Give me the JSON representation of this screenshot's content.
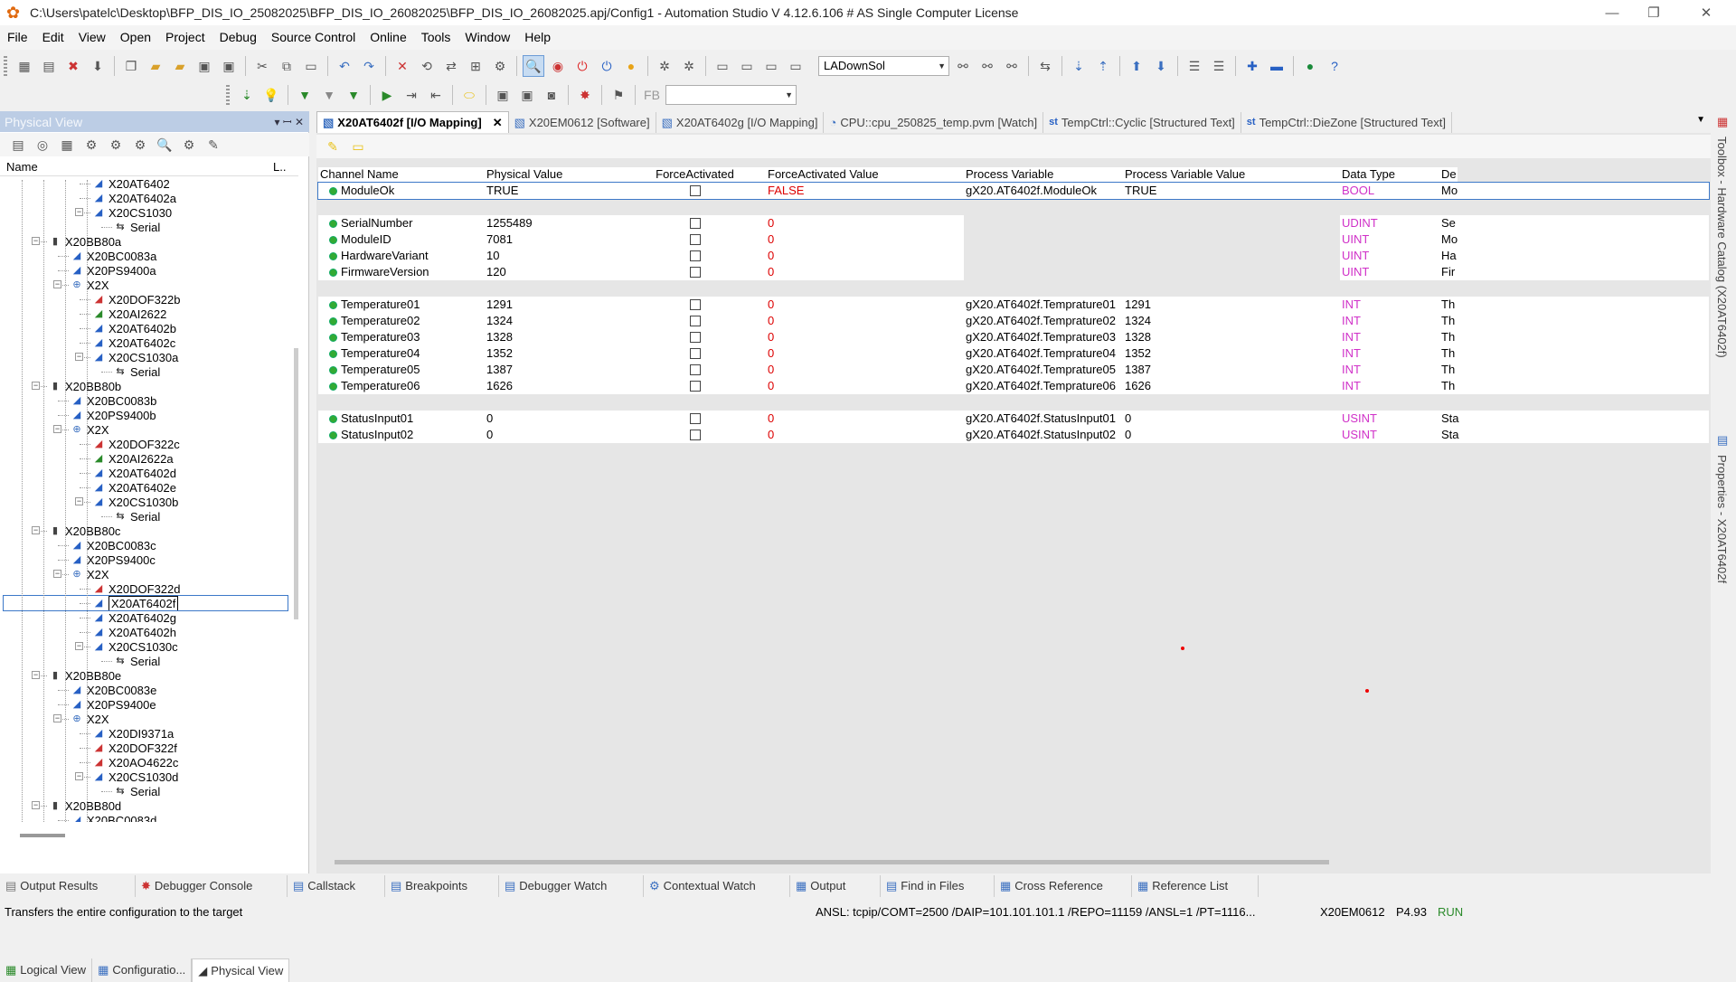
{
  "window": {
    "title": "C:\\Users\\patelc\\Desktop\\BFP_DIS_IO_25082025\\BFP_DIS_IO_26082025\\BFP_DIS_IO_26082025.apj/Config1 - Automation Studio V 4.12.6.106 # AS Single Computer License",
    "minimize": "—",
    "restore": "❐",
    "close": "✕"
  },
  "menu": [
    "File",
    "Edit",
    "View",
    "Open",
    "Project",
    "Debug",
    "Source Control",
    "Online",
    "Tools",
    "Window",
    "Help"
  ],
  "toolbar": {
    "combo_value": "LADownSol",
    "combo2_value": ""
  },
  "physical_view": {
    "title": "Physical View",
    "pin": "▾ ꟷ ✕",
    "col_name": "Name",
    "col_l": "L..",
    "tree": [
      {
        "label": "X20AT6402",
        "indent": 3,
        "icon": "module"
      },
      {
        "label": "X20AT6402a",
        "indent": 3,
        "icon": "module"
      },
      {
        "label": "X20CS1030",
        "indent": 3,
        "icon": "module",
        "expander": "-"
      },
      {
        "label": "Serial",
        "indent": 4,
        "icon": "serial"
      },
      {
        "label": "X20BB80a",
        "indent": 1,
        "icon": "bus",
        "expander": "-"
      },
      {
        "label": "X20BC0083a",
        "indent": 2,
        "icon": "module"
      },
      {
        "label": "X20PS9400a",
        "indent": 2,
        "icon": "module"
      },
      {
        "label": "X2X",
        "indent": 2,
        "icon": "x2x",
        "expander": "-"
      },
      {
        "label": "X20DOF322b",
        "indent": 3,
        "icon": "module-red"
      },
      {
        "label": "X20AI2622",
        "indent": 3,
        "icon": "module-green"
      },
      {
        "label": "X20AT6402b",
        "indent": 3,
        "icon": "module"
      },
      {
        "label": "X20AT6402c",
        "indent": 3,
        "icon": "module"
      },
      {
        "label": "X20CS1030a",
        "indent": 3,
        "icon": "module",
        "expander": "-"
      },
      {
        "label": "Serial",
        "indent": 4,
        "icon": "serial"
      },
      {
        "label": "X20BB80b",
        "indent": 1,
        "icon": "bus",
        "expander": "-"
      },
      {
        "label": "X20BC0083b",
        "indent": 2,
        "icon": "module"
      },
      {
        "label": "X20PS9400b",
        "indent": 2,
        "icon": "module"
      },
      {
        "label": "X2X",
        "indent": 2,
        "icon": "x2x",
        "expander": "-"
      },
      {
        "label": "X20DOF322c",
        "indent": 3,
        "icon": "module-red"
      },
      {
        "label": "X20AI2622a",
        "indent": 3,
        "icon": "module-green"
      },
      {
        "label": "X20AT6402d",
        "indent": 3,
        "icon": "module"
      },
      {
        "label": "X20AT6402e",
        "indent": 3,
        "icon": "module"
      },
      {
        "label": "X20CS1030b",
        "indent": 3,
        "icon": "module",
        "expander": "-"
      },
      {
        "label": "Serial",
        "indent": 4,
        "icon": "serial"
      },
      {
        "label": "X20BB80c",
        "indent": 1,
        "icon": "bus",
        "expander": "-"
      },
      {
        "label": "X20BC0083c",
        "indent": 2,
        "icon": "module"
      },
      {
        "label": "X20PS9400c",
        "indent": 2,
        "icon": "module"
      },
      {
        "label": "X2X",
        "indent": 2,
        "icon": "x2x",
        "expander": "-"
      },
      {
        "label": "X20DOF322d",
        "indent": 3,
        "icon": "module-red"
      },
      {
        "label": "X20AT6402f",
        "indent": 3,
        "icon": "module",
        "selected": true
      },
      {
        "label": "X20AT6402g",
        "indent": 3,
        "icon": "module"
      },
      {
        "label": "X20AT6402h",
        "indent": 3,
        "icon": "module"
      },
      {
        "label": "X20CS1030c",
        "indent": 3,
        "icon": "module",
        "expander": "-"
      },
      {
        "label": "Serial",
        "indent": 4,
        "icon": "serial"
      },
      {
        "label": "X20BB80e",
        "indent": 1,
        "icon": "bus",
        "expander": "-"
      },
      {
        "label": "X20BC0083e",
        "indent": 2,
        "icon": "module"
      },
      {
        "label": "X20PS9400e",
        "indent": 2,
        "icon": "module"
      },
      {
        "label": "X2X",
        "indent": 2,
        "icon": "x2x",
        "expander": "-"
      },
      {
        "label": "X20DI9371a",
        "indent": 3,
        "icon": "module"
      },
      {
        "label": "X20DOF322f",
        "indent": 3,
        "icon": "module-red"
      },
      {
        "label": "X20AO4622c",
        "indent": 3,
        "icon": "module-red"
      },
      {
        "label": "X20CS1030d",
        "indent": 3,
        "icon": "module",
        "expander": "-"
      },
      {
        "label": "Serial",
        "indent": 4,
        "icon": "serial"
      },
      {
        "label": "X20BB80d",
        "indent": 1,
        "icon": "bus",
        "expander": "-"
      },
      {
        "label": "X20BC0083d",
        "indent": 2,
        "icon": "module"
      }
    ],
    "tabs": [
      {
        "label": "Logical View",
        "active": false
      },
      {
        "label": "Configuratio...",
        "active": false
      },
      {
        "label": "Physical View",
        "active": true
      }
    ]
  },
  "doc_tabs": [
    {
      "label": "X20AT6402f [I/O Mapping]",
      "active": true
    },
    {
      "label": "X20EM0612 [Software]",
      "active": false
    },
    {
      "label": "X20AT6402g [I/O Mapping]",
      "active": false
    },
    {
      "label": "CPU::cpu_250825_temp.pvm [Watch]",
      "active": false
    },
    {
      "label": "TempCtrl::Cyclic [Structured Text]",
      "active": false
    },
    {
      "label": "TempCtrl::DieZone [Structured Text]",
      "active": false
    }
  ],
  "grid": {
    "headers": [
      "Channel Name",
      "Physical Value",
      "ForceActivated",
      "ForceActivated Value",
      "Process Variable",
      "Process Variable Value",
      "Data Type",
      "De"
    ],
    "rows": [
      {
        "name": "ModuleOk",
        "phys": "TRUE",
        "fav": "FALSE",
        "pv": "gX20.AT6402f.ModuleOk",
        "pvv": "TRUE",
        "type": "BOOL",
        "desc": "Mo",
        "group": 0
      },
      {
        "name": "SerialNumber",
        "phys": "1255489",
        "fav": "0",
        "pv": "",
        "pvv": "",
        "type": "UDINT",
        "desc": "Se",
        "group": 1
      },
      {
        "name": "ModuleID",
        "phys": "7081",
        "fav": "0",
        "pv": "",
        "pvv": "",
        "type": "UINT",
        "desc": "Mo",
        "group": 1
      },
      {
        "name": "HardwareVariant",
        "phys": "10",
        "fav": "0",
        "pv": "",
        "pvv": "",
        "type": "UINT",
        "desc": "Ha",
        "group": 1
      },
      {
        "name": "FirmwareVersion",
        "phys": "120",
        "fav": "0",
        "pv": "",
        "pvv": "",
        "type": "UINT",
        "desc": "Fir",
        "group": 1
      },
      {
        "name": "Temperature01",
        "phys": "1291",
        "fav": "0",
        "pv": "gX20.AT6402f.Temprature01",
        "pvv": "1291",
        "type": "INT",
        "desc": "Th",
        "group": 2
      },
      {
        "name": "Temperature02",
        "phys": "1324",
        "fav": "0",
        "pv": "gX20.AT6402f.Temprature02",
        "pvv": "1324",
        "type": "INT",
        "desc": "Th",
        "group": 2
      },
      {
        "name": "Temperature03",
        "phys": "1328",
        "fav": "0",
        "pv": "gX20.AT6402f.Temprature03",
        "pvv": "1328",
        "type": "INT",
        "desc": "Th",
        "group": 2
      },
      {
        "name": "Temperature04",
        "phys": "1352",
        "fav": "0",
        "pv": "gX20.AT6402f.Temprature04",
        "pvv": "1352",
        "type": "INT",
        "desc": "Th",
        "group": 2
      },
      {
        "name": "Temperature05",
        "phys": "1387",
        "fav": "0",
        "pv": "gX20.AT6402f.Temprature05",
        "pvv": "1387",
        "type": "INT",
        "desc": "Th",
        "group": 2
      },
      {
        "name": "Temperature06",
        "phys": "1626",
        "fav": "0",
        "pv": "gX20.AT6402f.Temprature06",
        "pvv": "1626",
        "type": "INT",
        "desc": "Th",
        "group": 2
      },
      {
        "name": "StatusInput01",
        "phys": "0",
        "fav": "0",
        "pv": "gX20.AT6402f.StatusInput01",
        "pvv": "0",
        "type": "USINT",
        "desc": "Sta",
        "group": 3
      },
      {
        "name": "StatusInput02",
        "phys": "0",
        "fav": "0",
        "pv": "gX20.AT6402f.StatusInput02",
        "pvv": "0",
        "type": "USINT",
        "desc": "Sta",
        "group": 3
      }
    ]
  },
  "side_panel": {
    "toolbox": "Toolbox - Hardware Catalog (X20AT6402f)",
    "properties": "Properties - X20AT6402f"
  },
  "bottom_tabs": [
    "Output Results",
    "Debugger Console",
    "Callstack",
    "Breakpoints",
    "Debugger Watch",
    "Contextual Watch",
    "Output",
    "Find in Files",
    "Cross Reference",
    "Reference List"
  ],
  "status": {
    "message": "Transfers the entire configuration to the target",
    "connection": "ANSL: tcpip/COMT=2500 /DAIP=101.101.101.1 /REPO=11159 /ANSL=1 /PT=1116...",
    "cpu": "X20EM0612",
    "version": "P4.93",
    "state": "RUN"
  },
  "colors": {
    "accent": "#3c78c8",
    "red_value": "#dd0000",
    "type_color": "#d030c8",
    "run_green": "#2a8a2a"
  }
}
